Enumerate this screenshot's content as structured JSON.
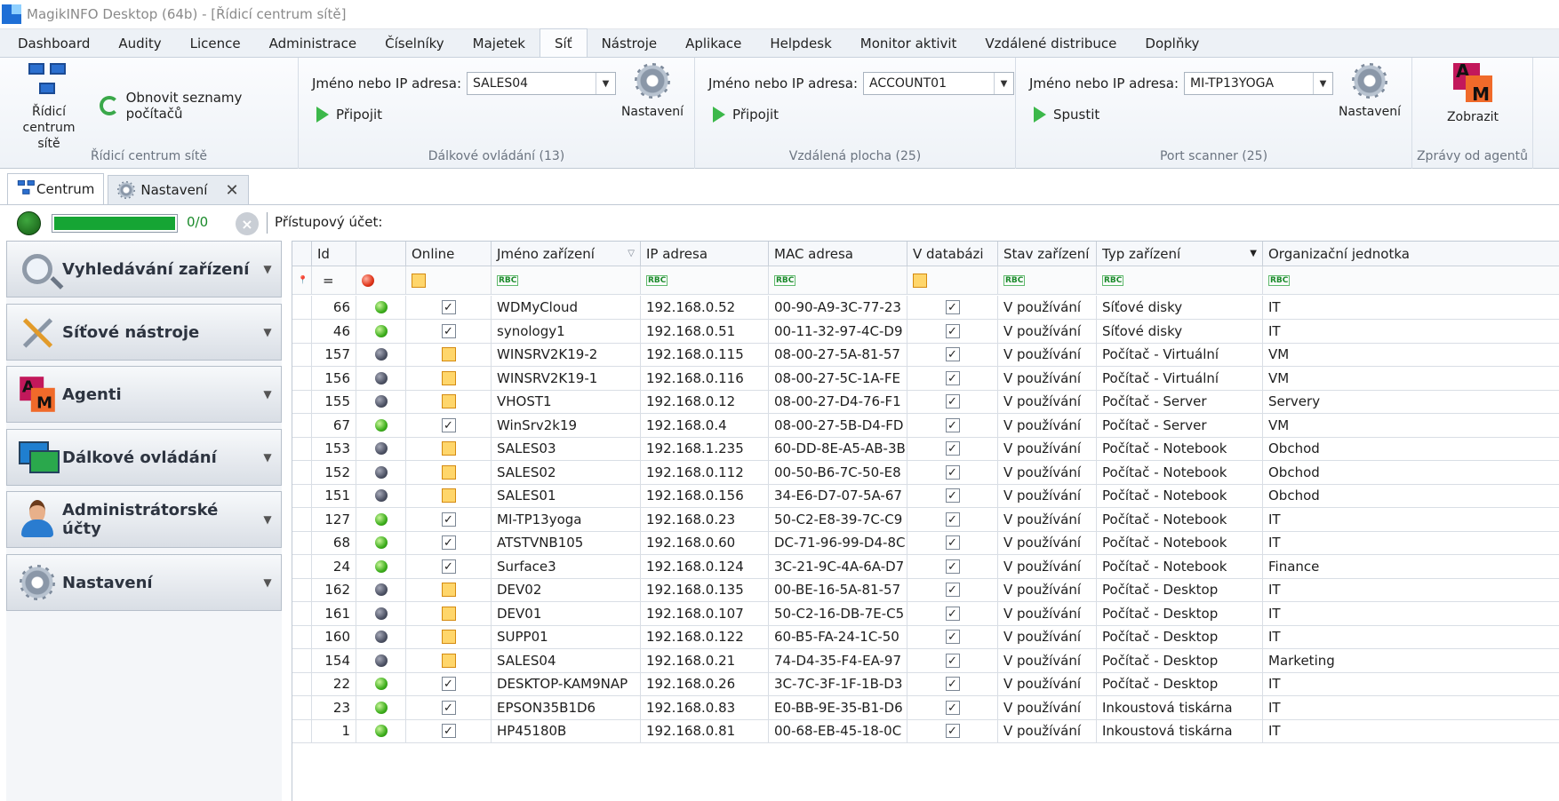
{
  "window": {
    "title": "MagikINFO Desktop (64b) - [Řídicí centrum sítě]"
  },
  "menu": [
    "Dashboard",
    "Audity",
    "Licence",
    "Administrace",
    "Číselníky",
    "Majetek",
    "Síť",
    "Nástroje",
    "Aplikace",
    "Helpdesk",
    "Monitor aktivit",
    "Vzdálené distribuce",
    "Doplňky"
  ],
  "menu_active": "Síť",
  "ribbon": {
    "network": {
      "big_label": "Řídicí centrum sítě",
      "refresh_label": "Obnovit seznamy počítačů",
      "caption": "Řídicí centrum sítě"
    },
    "remote": {
      "field_label": "Jméno nebo IP adresa:",
      "value": "SALES04",
      "connect": "Připojit",
      "settings": "Nastavení",
      "caption": "Dálkové ovládání (13)"
    },
    "desktop": {
      "field_label": "Jméno nebo IP adresa:",
      "value": "ACCOUNT01",
      "connect": "Připojit",
      "caption": "Vzdálená plocha (25)"
    },
    "scanner": {
      "field_label": "Jméno nebo IP adresa:",
      "value": "MI-TP13YOGA",
      "start": "Spustit",
      "settings": "Nastavení",
      "caption": "Port scanner (25)"
    },
    "agents": {
      "show": "Zobrazit",
      "caption": "Zprávy od agentů",
      "logo_a": "A",
      "logo_m": "M"
    }
  },
  "doc_tabs": [
    "Centrum",
    "Nastavení"
  ],
  "status": {
    "progress_text": "0/0",
    "progress_fraction": 1.0,
    "account_label": "Přístupový účet:",
    "cancel_symbol": "×"
  },
  "nav": [
    {
      "label": "Vyhledávání zařízení",
      "icon": "search-icon"
    },
    {
      "label": "Síťové nástroje",
      "icon": "tools-icon"
    },
    {
      "label": "Agenti",
      "icon": "agents-logo-icon"
    },
    {
      "label": "Dálkové ovládání",
      "icon": "remote-control-icon"
    },
    {
      "label": "Administrátorské účty",
      "icon": "admin-user-icon"
    },
    {
      "label": "Nastavení",
      "icon": "gear-icon"
    }
  ],
  "grid": {
    "columns": [
      "",
      "Id",
      "",
      "Online",
      "Jméno zařízení",
      "IP adresa",
      "MAC adresa",
      "V databázi",
      "Stav zařízení",
      "Typ zařízení",
      "Organizační jednotka"
    ],
    "filter_row": {
      "id_op": "=",
      "text_filter_glyph": "RBC"
    },
    "rows": [
      {
        "id": 66,
        "on": true,
        "name": "WDMyCloud",
        "ip": "192.168.0.52",
        "mac": "00-90-A9-3C-77-23",
        "db": true,
        "state": "V používání",
        "type": "Síťové disky",
        "org": "IT"
      },
      {
        "id": 46,
        "on": true,
        "name": "synology1",
        "ip": "192.168.0.51",
        "mac": "00-11-32-97-4C-D9",
        "db": true,
        "state": "V používání",
        "type": "Síťové disky",
        "org": "IT"
      },
      {
        "id": 157,
        "on": false,
        "name": "WINSRV2K19-2",
        "ip": "192.168.0.115",
        "mac": "08-00-27-5A-81-57",
        "db": true,
        "state": "V používání",
        "type": "Počítač - Virtuální",
        "org": "VM"
      },
      {
        "id": 156,
        "on": false,
        "name": "WINSRV2K19-1",
        "ip": "192.168.0.116",
        "mac": "08-00-27-5C-1A-FE",
        "db": true,
        "state": "V používání",
        "type": "Počítač - Virtuální",
        "org": "VM"
      },
      {
        "id": 155,
        "on": false,
        "name": "VHOST1",
        "ip": "192.168.0.12",
        "mac": "08-00-27-D4-76-F1",
        "db": true,
        "state": "V používání",
        "type": "Počítač - Server",
        "org": "Servery"
      },
      {
        "id": 67,
        "on": true,
        "name": "WinSrv2k19",
        "ip": "192.168.0.4",
        "mac": "08-00-27-5B-D4-FD",
        "db": true,
        "state": "V používání",
        "type": "Počítač - Server",
        "org": "VM"
      },
      {
        "id": 153,
        "on": false,
        "name": "SALES03",
        "ip": "192.168.1.235",
        "mac": "60-DD-8E-A5-AB-3B",
        "db": true,
        "state": "V používání",
        "type": "Počítač - Notebook",
        "org": "Obchod"
      },
      {
        "id": 152,
        "on": false,
        "name": "SALES02",
        "ip": "192.168.0.112",
        "mac": "00-50-B6-7C-50-E8",
        "db": true,
        "state": "V používání",
        "type": "Počítač - Notebook",
        "org": "Obchod"
      },
      {
        "id": 151,
        "on": false,
        "name": "SALES01",
        "ip": "192.168.0.156",
        "mac": "34-E6-D7-07-5A-67",
        "db": true,
        "state": "V používání",
        "type": "Počítač - Notebook",
        "org": "Obchod"
      },
      {
        "id": 127,
        "on": true,
        "name": "MI-TP13yoga",
        "ip": "192.168.0.23",
        "mac": "50-C2-E8-39-7C-C9",
        "db": true,
        "state": "V používání",
        "type": "Počítač - Notebook",
        "org": "IT"
      },
      {
        "id": 68,
        "on": true,
        "name": "ATSTVNB105",
        "ip": "192.168.0.60",
        "mac": "DC-71-96-99-D4-8C",
        "db": true,
        "state": "V používání",
        "type": "Počítač - Notebook",
        "org": "IT"
      },
      {
        "id": 24,
        "on": true,
        "name": "Surface3",
        "ip": "192.168.0.124",
        "mac": "3C-21-9C-4A-6A-D7",
        "db": true,
        "state": "V používání",
        "type": "Počítač - Notebook",
        "org": "Finance"
      },
      {
        "id": 162,
        "on": false,
        "name": "DEV02",
        "ip": "192.168.0.135",
        "mac": "00-BE-16-5A-81-57",
        "db": true,
        "state": "V používání",
        "type": "Počítač - Desktop",
        "org": "IT"
      },
      {
        "id": 161,
        "on": false,
        "name": "DEV01",
        "ip": "192.168.0.107",
        "mac": "50-C2-16-DB-7E-C5",
        "db": true,
        "state": "V používání",
        "type": "Počítač - Desktop",
        "org": "IT"
      },
      {
        "id": 160,
        "on": false,
        "name": "SUPP01",
        "ip": "192.168.0.122",
        "mac": "60-B5-FA-24-1C-50",
        "db": true,
        "state": "V používání",
        "type": "Počítač - Desktop",
        "org": "IT"
      },
      {
        "id": 154,
        "on": false,
        "name": "SALES04",
        "ip": "192.168.0.21",
        "mac": "74-D4-35-F4-EA-97",
        "db": true,
        "state": "V používání",
        "type": "Počítač - Desktop",
        "org": "Marketing"
      },
      {
        "id": 22,
        "on": true,
        "name": "DESKTOP-KAM9NAP",
        "ip": "192.168.0.26",
        "mac": "3C-7C-3F-1F-1B-D3",
        "db": true,
        "state": "V používání",
        "type": "Počítač - Desktop",
        "org": "IT"
      },
      {
        "id": 23,
        "on": true,
        "name": "EPSON35B1D6",
        "ip": "192.168.0.83",
        "mac": "E0-BB-9E-35-B1-D6",
        "db": true,
        "state": "V používání",
        "type": "Inkoustová tiskárna",
        "org": "IT"
      },
      {
        "id": 1,
        "on": true,
        "name": "HP45180B",
        "ip": "192.168.0.81",
        "mac": "00-68-EB-45-18-0C",
        "db": true,
        "state": "V používání",
        "type": "Inkoustová tiskárna",
        "org": "IT"
      }
    ]
  }
}
